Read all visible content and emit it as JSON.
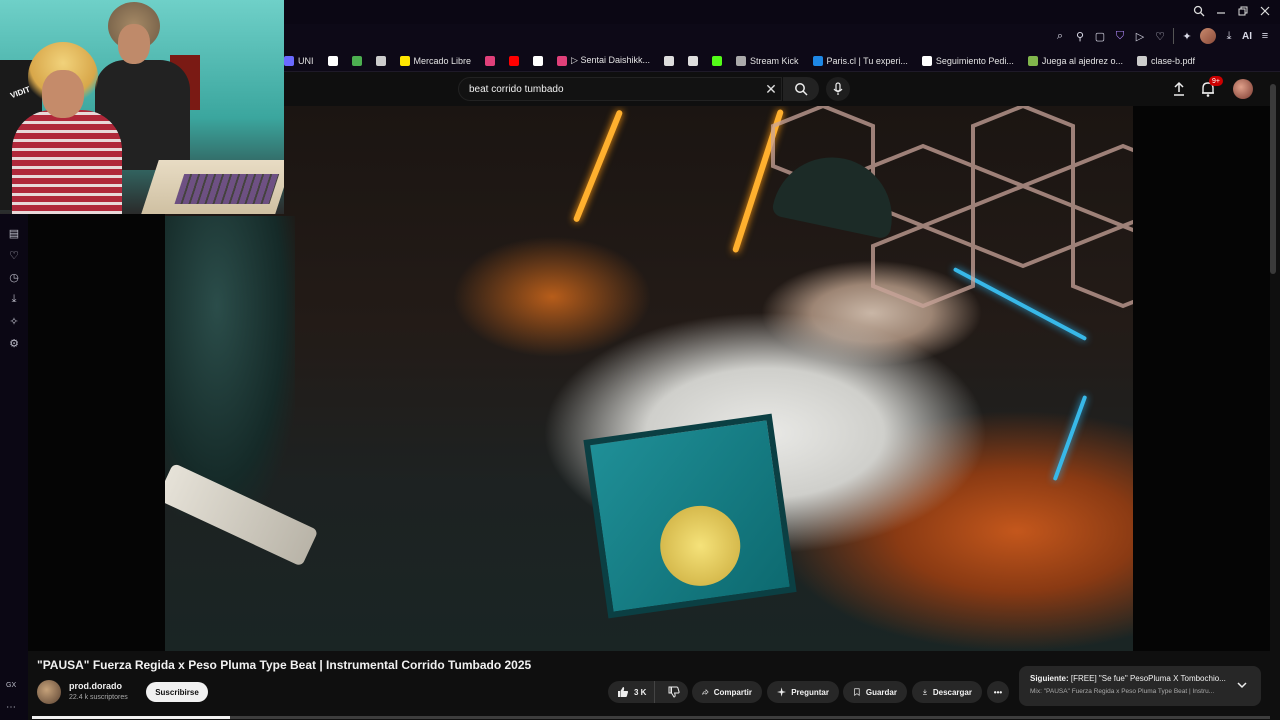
{
  "browser": {
    "window_controls": [
      "search-icon",
      "minimize-icon",
      "restore-icon",
      "close-icon"
    ],
    "extensions": [
      "zoom-icon",
      "bookmark-icon",
      "snapshot-icon",
      "shield-icon",
      "play-icon",
      "heart-icon",
      "puzzle-icon",
      "profile-icon",
      "download-icon",
      "ai-icon",
      "menu-icon"
    ],
    "ai_label": "AI"
  },
  "bookmarks": [
    {
      "label": "UNI",
      "color": "#6a6aff"
    },
    {
      "label": "",
      "icon": "x-icon",
      "color": "#ffffff"
    },
    {
      "label": "",
      "icon": "leaf-icon",
      "color": "#4caf50"
    },
    {
      "label": "",
      "icon": "monster-icon",
      "color": "#cccccc"
    },
    {
      "label": "Mercado Libre",
      "color": "#ffe600"
    },
    {
      "label": "",
      "icon": "app-icon",
      "color": "#e0407a"
    },
    {
      "label": "",
      "icon": "youtube-icon",
      "color": "#ff0000"
    },
    {
      "label": "",
      "icon": "a-icon",
      "color": "#ffffff"
    },
    {
      "label": "▷ Sentai Daishikk...",
      "color": "#e0407a"
    },
    {
      "label": "",
      "icon": "record-icon",
      "color": "#dddddd"
    },
    {
      "label": "",
      "icon": "s-icon",
      "color": "#dddddd"
    },
    {
      "label": "",
      "icon": "k-icon",
      "color": "#53fc18"
    },
    {
      "label": "Stream Kick",
      "color": "#aaaaaa"
    },
    {
      "label": "Paris.cl | Tu experi...",
      "color": "#1e88e5"
    },
    {
      "label": "Seguimiento Pedi...",
      "color": "#ffffff"
    },
    {
      "label": "Juega al ajedrez o...",
      "color": "#81b64c"
    },
    {
      "label": "clase-b.pdf",
      "color": "#cccccc"
    }
  ],
  "search": {
    "value": "beat corrido tumbado"
  },
  "header": {
    "notifications_badge": "9+"
  },
  "webcam": {
    "chair_brand": "VIDIT"
  },
  "video": {
    "title": "\"PAUSA\" Fuerza Regida x Peso Pluma Type Beat | Instrumental Corrido Tumbado 2025",
    "channel": "prod.dorado",
    "subscribers": "22.4 k suscriptores",
    "subscribe_label": "Suscribirse",
    "likes": "3 K",
    "share_label": "Compartir",
    "ask_label": "Preguntar",
    "save_label": "Guardar",
    "download_label": "Descargar",
    "progress": 0.16
  },
  "up_next": {
    "prefix": "Siguiente:",
    "title": "[FREE] \"Se fue\" PesoPluma X Tombochio...",
    "subtitle": "Mix: \"PAUSA\" Fuerza Regida x Peso Pluma Type Beat | Instru..."
  },
  "sidebar": {
    "bottom_label": "GX"
  }
}
